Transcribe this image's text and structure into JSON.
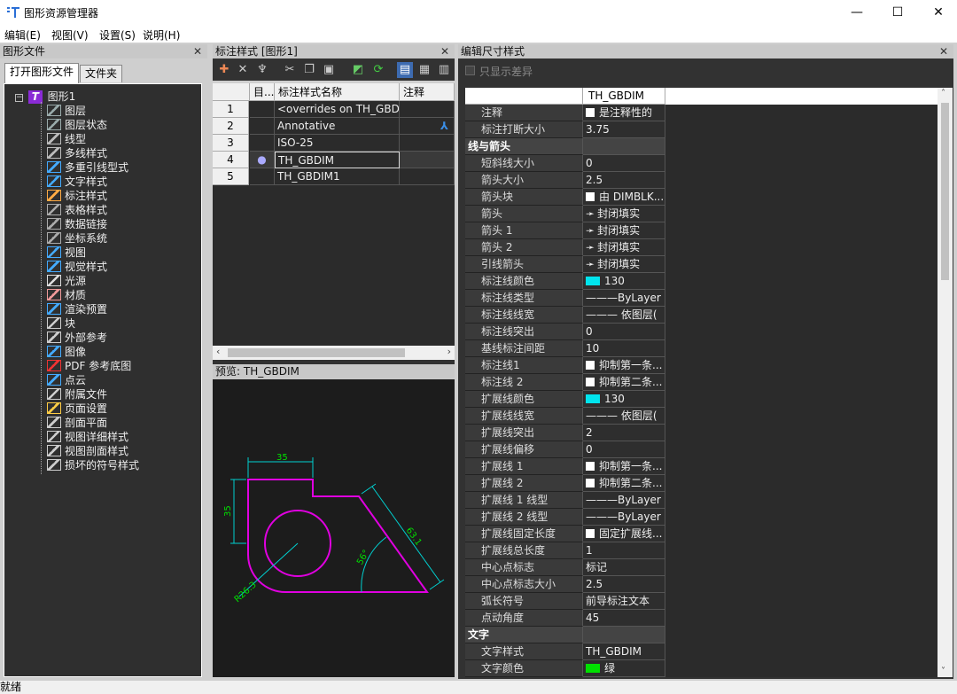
{
  "window": {
    "title": "图形资源管理器",
    "min": "—",
    "max": "☐",
    "close": "✕"
  },
  "menu": [
    "编辑(E)",
    "视图(V)",
    "设置(S)",
    "说明(H)"
  ],
  "left_panel": {
    "title": "图形文件",
    "tabs": [
      "打开图形文件",
      "文件夹"
    ],
    "root": "图形1",
    "items": [
      {
        "label": "图层",
        "icon": "layers-icon",
        "color": "#9aa"
      },
      {
        "label": "图层状态",
        "icon": "layer-state-icon",
        "color": "#9aa"
      },
      {
        "label": "线型",
        "icon": "linetype-icon",
        "color": "#bbb"
      },
      {
        "label": "多线样式",
        "icon": "multiline-icon",
        "color": "#bbb"
      },
      {
        "label": "多重引线型式",
        "icon": "multileader-icon",
        "color": "#4af"
      },
      {
        "label": "文字样式",
        "icon": "text-style-icon",
        "color": "#4af"
      },
      {
        "label": "标注样式",
        "icon": "dim-style-icon",
        "color": "#fa4"
      },
      {
        "label": "表格样式",
        "icon": "table-style-icon",
        "color": "#aaa"
      },
      {
        "label": "数据链接",
        "icon": "data-link-icon",
        "color": "#aaa"
      },
      {
        "label": "坐标系统",
        "icon": "ucs-icon",
        "color": "#aaa"
      },
      {
        "label": "视图",
        "icon": "view-icon",
        "color": "#4af"
      },
      {
        "label": "视觉样式",
        "icon": "visual-style-icon",
        "color": "#4af"
      },
      {
        "label": "光源",
        "icon": "light-icon",
        "color": "#ddd"
      },
      {
        "label": "材质",
        "icon": "material-icon",
        "color": "#e99"
      },
      {
        "label": "渲染预置",
        "icon": "render-preset-icon",
        "color": "#4af"
      },
      {
        "label": "块",
        "icon": "block-icon",
        "color": "#ccc"
      },
      {
        "label": "外部参考",
        "icon": "xref-icon",
        "color": "#ccc"
      },
      {
        "label": "图像",
        "icon": "image-icon",
        "color": "#4af"
      },
      {
        "label": "PDF 参考底图",
        "icon": "pdf-icon",
        "color": "#e33"
      },
      {
        "label": "点云",
        "icon": "point-cloud-icon",
        "color": "#4af"
      },
      {
        "label": "附属文件",
        "icon": "attached-file-icon",
        "color": "#ccc"
      },
      {
        "label": "页面设置",
        "icon": "page-setup-icon",
        "color": "#fc4"
      },
      {
        "label": "剖面平面",
        "icon": "section-plane-icon",
        "color": "#ccc"
      },
      {
        "label": "视图详细样式",
        "icon": "detail-view-icon",
        "color": "#ccc"
      },
      {
        "label": "视图剖面样式",
        "icon": "section-view-icon",
        "color": "#ccc"
      },
      {
        "label": "损坏的符号样式",
        "icon": "broken-symbol-icon",
        "color": "#ccc"
      }
    ]
  },
  "mid_panel": {
    "title": "标注样式 [图形1]",
    "columns": [
      "目...",
      "标注样式名称",
      "注释"
    ],
    "rows": [
      {
        "num": "1",
        "current": "",
        "name": "<overrides on TH_GBDIM>",
        "annot": ""
      },
      {
        "num": "2",
        "current": "",
        "name": "Annotative",
        "annot": "⅄"
      },
      {
        "num": "3",
        "current": "",
        "name": "ISO-25",
        "annot": ""
      },
      {
        "num": "4",
        "current": "●",
        "name": "TH_GBDIM",
        "annot": ""
      },
      {
        "num": "5",
        "current": "",
        "name": "TH_GBDIM1",
        "annot": ""
      }
    ],
    "preview_title": "预览: TH_GBDIM",
    "preview_dims": {
      "top": "35",
      "left": "35",
      "angled": "63.1",
      "angle": "56°",
      "radius": "R26.3"
    }
  },
  "right_panel": {
    "title": "编辑尺寸样式",
    "only_diff": "只显示差异",
    "header_value": "TH_GBDIM",
    "rows": [
      {
        "k": "注释",
        "v": "是注释性的",
        "chk": true
      },
      {
        "k": "标注打断大小",
        "v": "3.75"
      },
      {
        "k": "线与箭头",
        "section": true
      },
      {
        "k": "短斜线大小",
        "v": "0"
      },
      {
        "k": "箭头大小",
        "v": "2.5"
      },
      {
        "k": "箭头块",
        "v": "由 DIMBLK...",
        "chk": true
      },
      {
        "k": "箭头",
        "v": "封闭填实",
        "arrow": true
      },
      {
        "k": "箭头 1",
        "v": "封闭填实",
        "arrow": true
      },
      {
        "k": "箭头 2",
        "v": "封闭填实",
        "arrow": true
      },
      {
        "k": "引线箭头",
        "v": "封闭填实",
        "arrow": true
      },
      {
        "k": "标注线颜色",
        "v": "130",
        "swatch": "#00e5ee"
      },
      {
        "k": "标注线类型",
        "v": "———ByLayer"
      },
      {
        "k": "标注线线宽",
        "v": "——— 依图层("
      },
      {
        "k": "标注线突出",
        "v": "0"
      },
      {
        "k": "基线标注间距",
        "v": "10"
      },
      {
        "k": "标注线1",
        "v": "抑制第一条...",
        "chk": true
      },
      {
        "k": "标注线 2",
        "v": "抑制第二条...",
        "chk": true
      },
      {
        "k": "扩展线颜色",
        "v": "130",
        "swatch": "#00e5ee"
      },
      {
        "k": "扩展线线宽",
        "v": "——— 依图层("
      },
      {
        "k": "扩展线突出",
        "v": "2"
      },
      {
        "k": "扩展线偏移",
        "v": "0"
      },
      {
        "k": "扩展线 1",
        "v": "抑制第一条...",
        "chk": true
      },
      {
        "k": "扩展线 2",
        "v": "抑制第二条...",
        "chk": true
      },
      {
        "k": "扩展线 1 线型",
        "v": "———ByLayer"
      },
      {
        "k": "扩展线 2 线型",
        "v": "———ByLayer"
      },
      {
        "k": "扩展线固定长度",
        "v": "固定扩展线...",
        "chk": true
      },
      {
        "k": "扩展线总长度",
        "v": "1"
      },
      {
        "k": "中心点标志",
        "v": "标记"
      },
      {
        "k": "中心点标志大小",
        "v": "2.5"
      },
      {
        "k": "弧长符号",
        "v": "前导标注文本"
      },
      {
        "k": "点动角度",
        "v": "45"
      },
      {
        "k": "文字",
        "section": true
      },
      {
        "k": "文字样式",
        "v": "TH_GBDIM"
      },
      {
        "k": "文字颜色",
        "v": "绿",
        "swatch": "#00e000"
      }
    ]
  },
  "status": "就绪"
}
